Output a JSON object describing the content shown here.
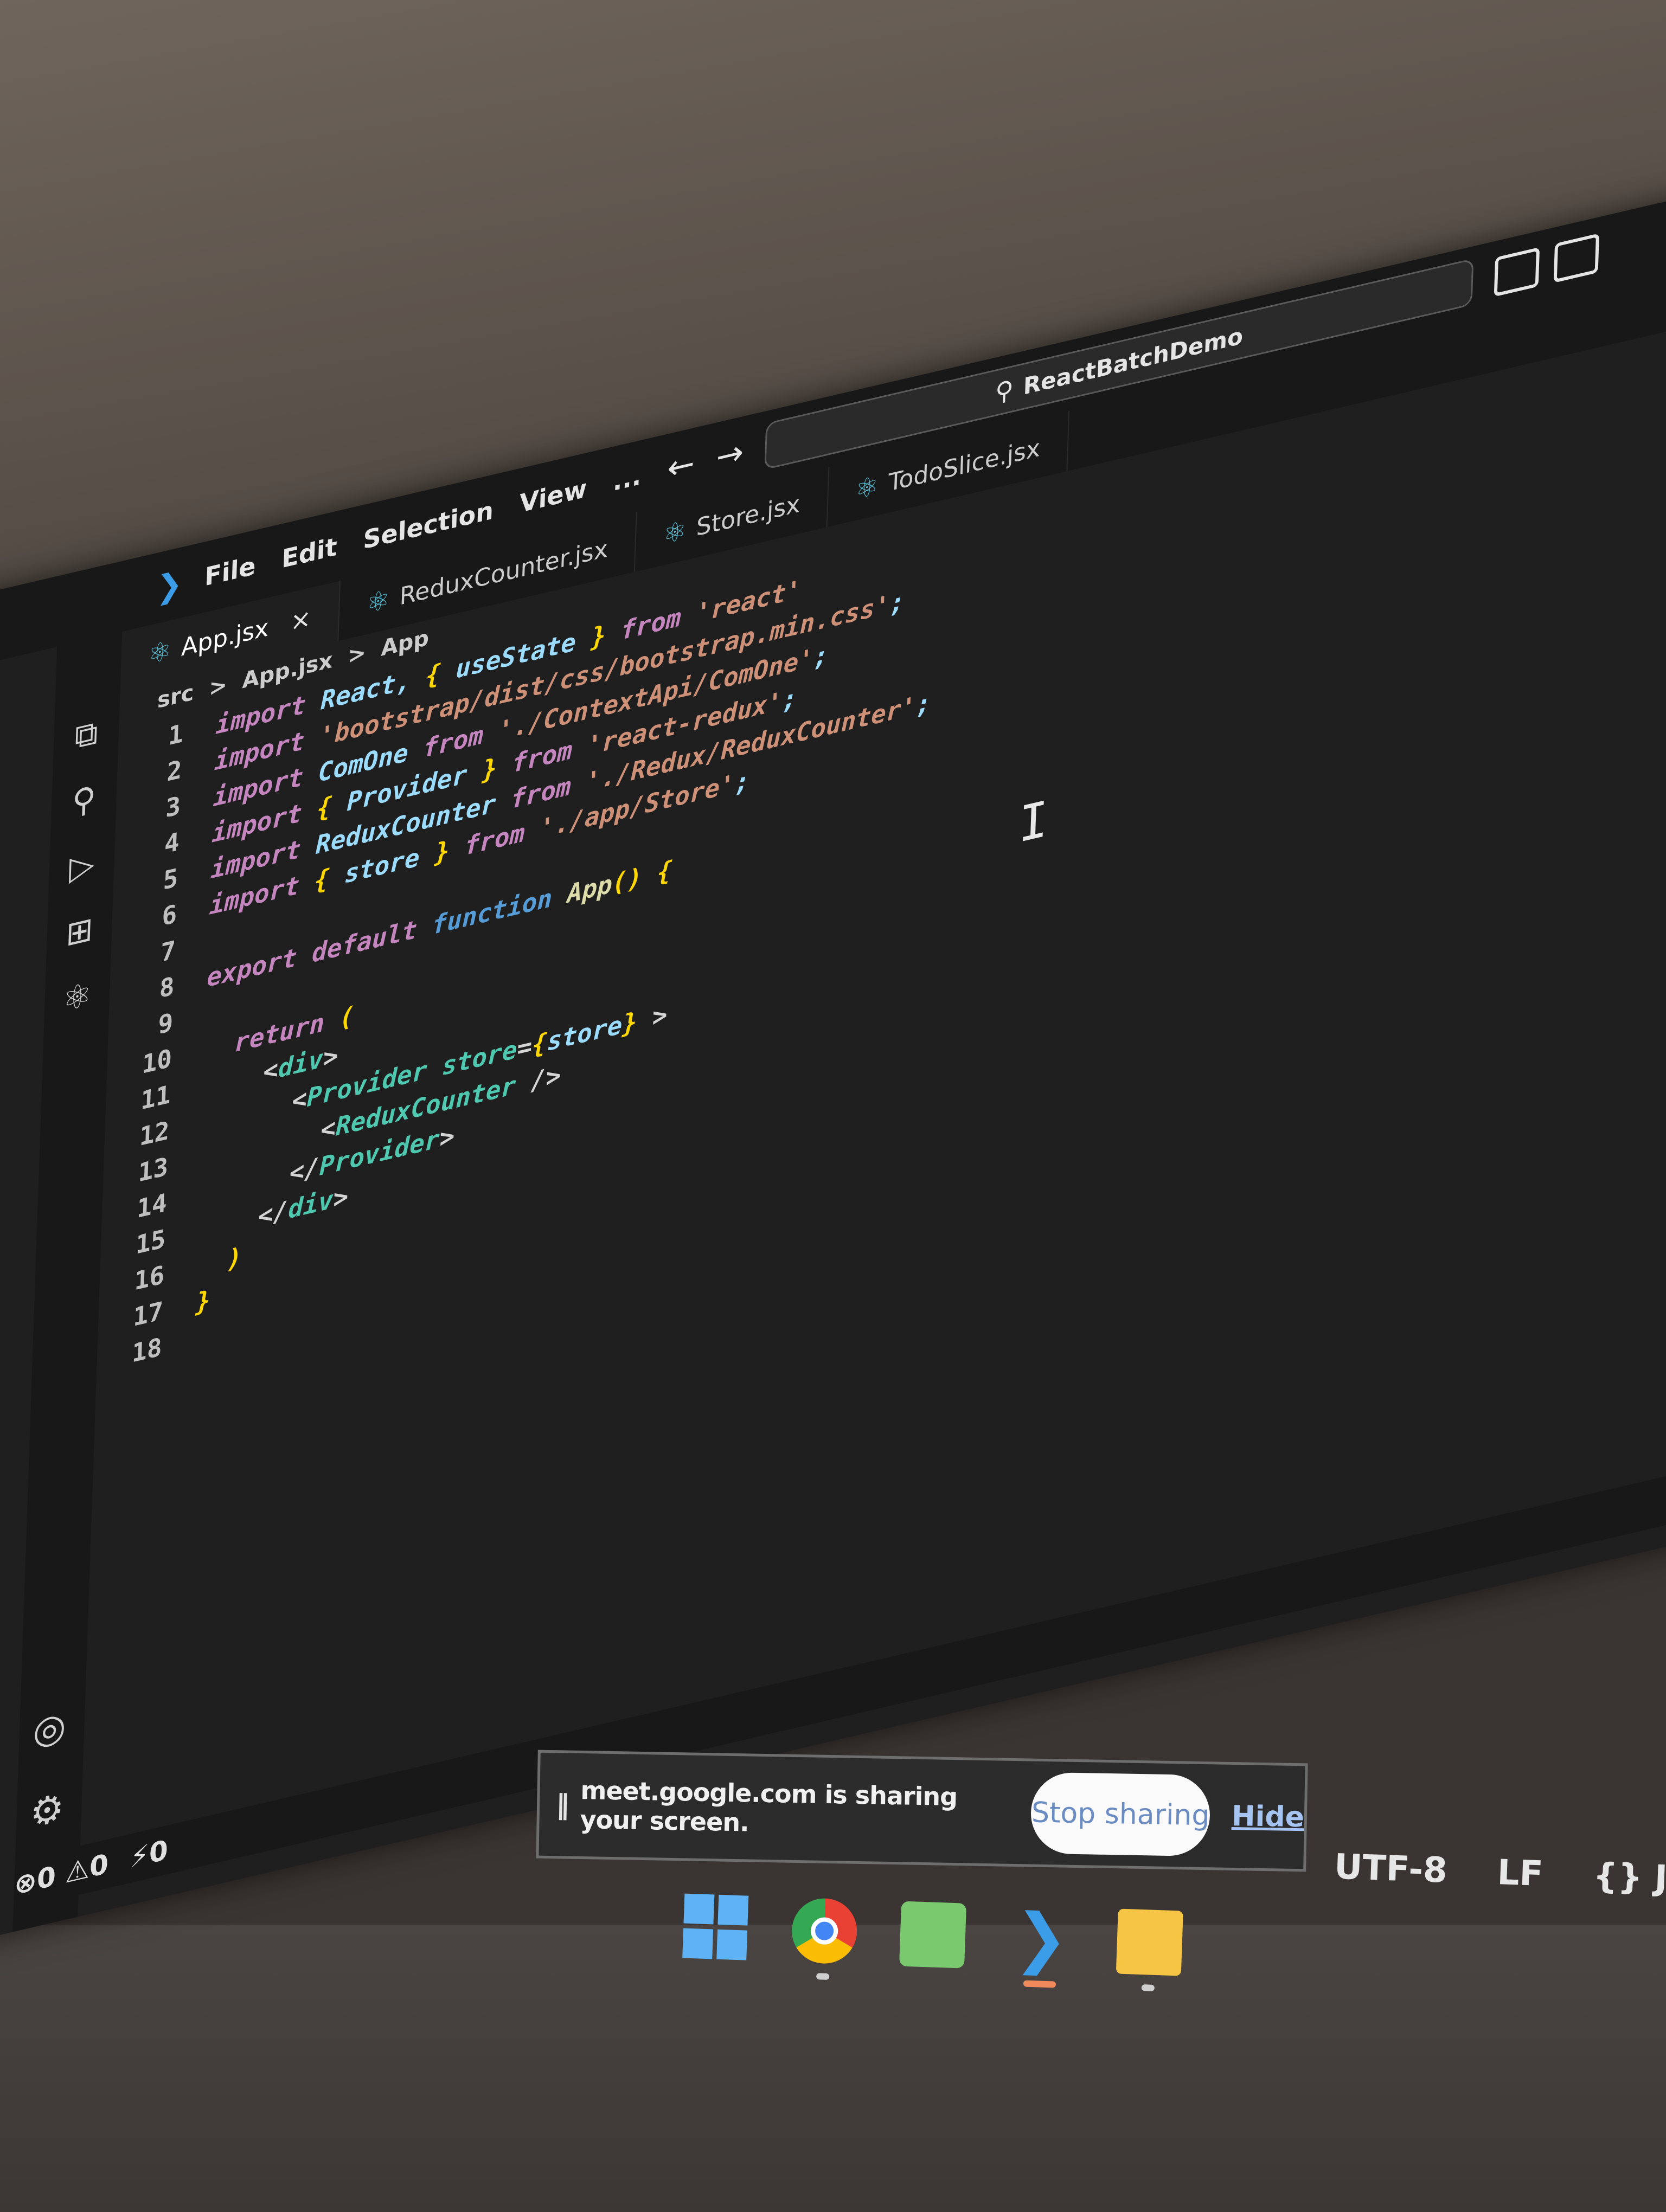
{
  "titlebar": {
    "menu": [
      "File",
      "Edit",
      "Selection",
      "View",
      "..."
    ],
    "search_text": "ReactBatchDemo"
  },
  "tabs": [
    {
      "label": "App.jsx",
      "active": true
    },
    {
      "label": "ReduxCounter.jsx",
      "active": false
    },
    {
      "label": "Store.jsx",
      "active": false
    },
    {
      "label": "TodoSlice.jsx",
      "active": false
    }
  ],
  "breadcrumb": [
    "src",
    ">",
    "App.jsx",
    ">",
    "App"
  ],
  "code_lines": [
    {
      "n": "1",
      "text": "import React, { useState } from 'react'"
    },
    {
      "n": "2",
      "text": "import 'bootstrap/dist/css/bootstrap.min.css';"
    },
    {
      "n": "3",
      "text": "import ComOne from './ContextApi/ComOne';"
    },
    {
      "n": "4",
      "text": "import { Provider } from 'react-redux';"
    },
    {
      "n": "5",
      "text": "import ReduxCounter from './Redux/ReduxCounter';"
    },
    {
      "n": "6",
      "text": "import { store } from './app/Store';"
    },
    {
      "n": "7",
      "text": ""
    },
    {
      "n": "8",
      "text": "export default function App() {"
    },
    {
      "n": "9",
      "text": ""
    },
    {
      "n": "10",
      "text": "  return ("
    },
    {
      "n": "11",
      "text": "    <div>"
    },
    {
      "n": "12",
      "text": "      <Provider store={store} >"
    },
    {
      "n": "13",
      "text": "        <ReduxCounter />"
    },
    {
      "n": "14",
      "text": "      </Provider>"
    },
    {
      "n": "15",
      "text": "    </div>"
    },
    {
      "n": "16",
      "text": "  )"
    },
    {
      "n": "17",
      "text": "}"
    },
    {
      "n": "18",
      "text": ""
    }
  ],
  "statusbar": {
    "errors": "0",
    "warnings": "0",
    "ports": "0",
    "encoding": "UTF-8",
    "eol": "LF",
    "language": "{} Jav"
  },
  "sharebar": {
    "text": "meet.google.com is sharing your screen.",
    "stop_label": "Stop sharing",
    "hide_label": "Hide"
  },
  "colors": {
    "editor_bg": "#1f1f1f",
    "keyword": "#c586c0",
    "string": "#ce9178",
    "identifier": "#9cdcfe",
    "tag": "#4ec9b0",
    "accent": "#3b9ce8"
  },
  "icons": [
    "vscode-icon",
    "explorer-icon",
    "search-icon",
    "run-debug-icon",
    "extensions-icon",
    "react-icon",
    "account-icon",
    "settings-gear-icon"
  ]
}
